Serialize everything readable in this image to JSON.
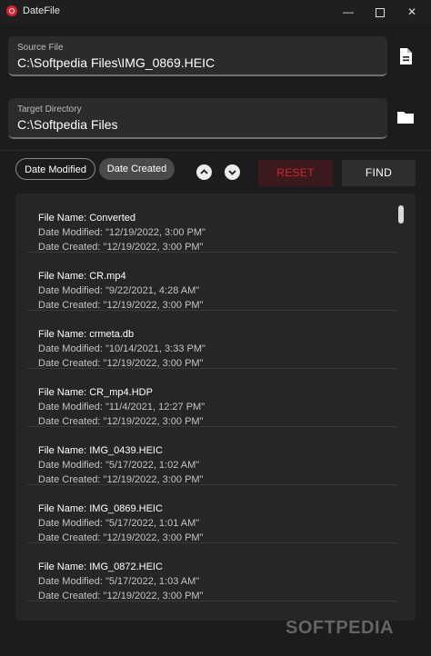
{
  "window": {
    "title": "DateFile",
    "controls": {
      "minimize": "—",
      "close": "✕"
    }
  },
  "source": {
    "label": "Source File",
    "value": "C:\\Softpedia Files\\IMG_0869.HEIC",
    "icon": "file-icon"
  },
  "target": {
    "label": "Target Directory",
    "value": "C:\\Softpedia Files",
    "icon": "folder-icon"
  },
  "sort": {
    "date_modified": "Date Modified",
    "date_created": "Date Created",
    "selected": "Date Created"
  },
  "actions": {
    "reset": "RESET",
    "find": "FIND"
  },
  "colors": {
    "accent": "#d8232f",
    "background": "#1c1c1c",
    "panel": "#262626"
  },
  "files": [
    {
      "name": "File Name: Converted",
      "modified": "Date Modified: \"12/19/2022, 3:00 PM\"",
      "created": "Date Created: \"12/19/2022, 3:00 PM\""
    },
    {
      "name": "File Name: CR.mp4",
      "modified": "Date Modified: \"9/22/2021, 4:28 AM\"",
      "created": "Date Created: \"12/19/2022, 3:00 PM\""
    },
    {
      "name": "File Name: crmeta.db",
      "modified": "Date Modified: \"10/14/2021, 3:33 PM\"",
      "created": "Date Created: \"12/19/2022, 3:00 PM\""
    },
    {
      "name": "File Name: CR_mp4.HDP",
      "modified": "Date Modified: \"11/4/2021, 12:27 PM\"",
      "created": "Date Created: \"12/19/2022, 3:00 PM\""
    },
    {
      "name": "File Name: IMG_0439.HEIC",
      "modified": "Date Modified: \"5/17/2022, 1:02 AM\"",
      "created": "Date Created: \"12/19/2022, 3:00 PM\""
    },
    {
      "name": "File Name: IMG_0869.HEIC",
      "modified": "Date Modified: \"5/17/2022, 1:01 AM\"",
      "created": "Date Created: \"12/19/2022, 3:00 PM\""
    },
    {
      "name": "File Name: IMG_0872.HEIC",
      "modified": "Date Modified: \"5/17/2022, 1:03 AM\"",
      "created": "Date Created: \"12/19/2022, 3:00 PM\""
    }
  ],
  "watermark": "SOFTPEDIA"
}
